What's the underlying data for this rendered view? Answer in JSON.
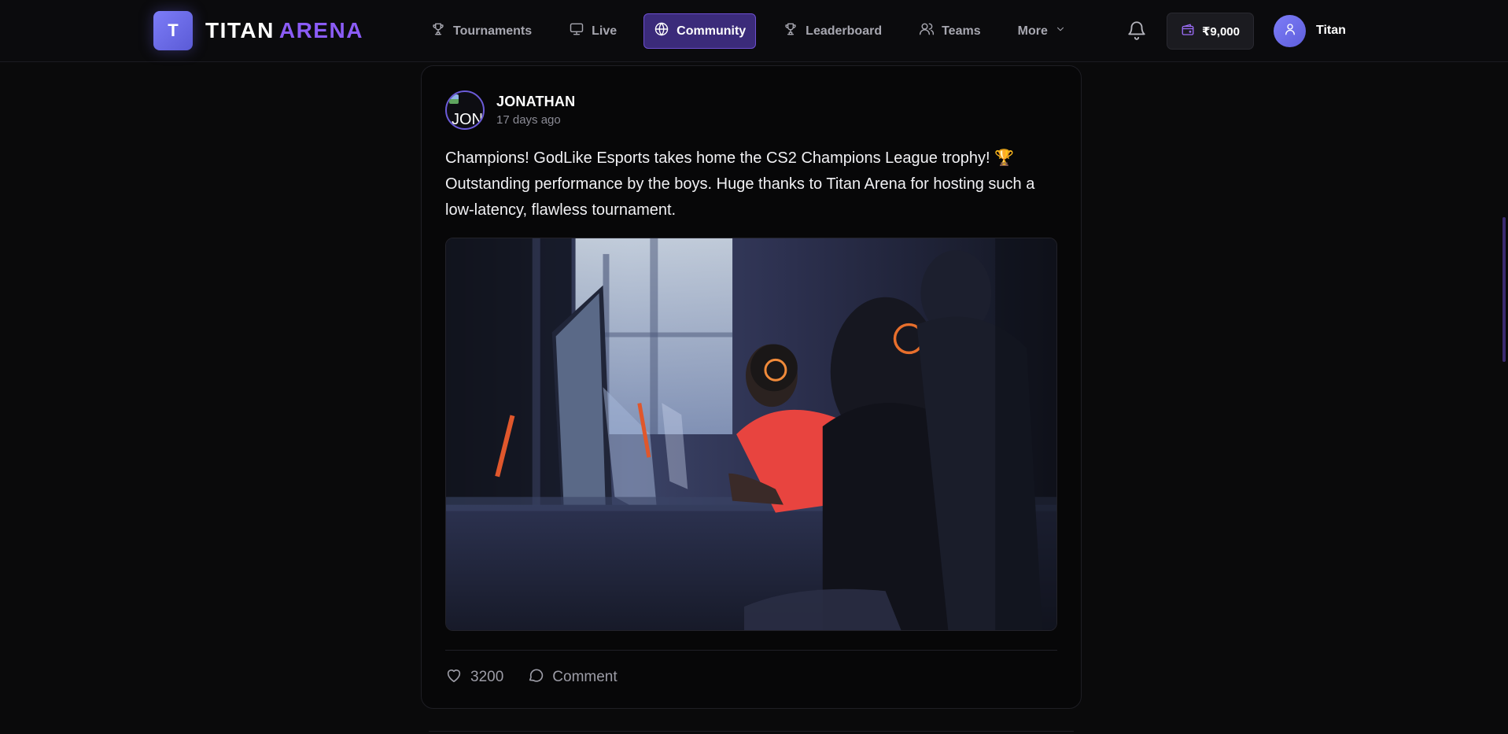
{
  "brand": {
    "badge_letter": "T",
    "word1": "TITAN",
    "word2": "ARENA",
    "accent": "#8b5cf6"
  },
  "nav": {
    "items": [
      {
        "label": "Tournaments",
        "icon": "trophy-icon"
      },
      {
        "label": "Live",
        "icon": "monitor-icon"
      },
      {
        "label": "Community",
        "icon": "globe-icon",
        "active": true
      },
      {
        "label": "Leaderboard",
        "icon": "trophy-icon"
      },
      {
        "label": "Teams",
        "icon": "users-icon"
      },
      {
        "label": "More",
        "icon": "chevron-down-icon"
      }
    ]
  },
  "header": {
    "wallet_balance": "₹9,000",
    "user_name": "Titan"
  },
  "post": {
    "author": "JONATHAN",
    "avatar_alt": "JON",
    "time": "17 days ago",
    "text": "Champions! GodLike Esports takes home the CS2 Champions League trophy! 🏆 Outstanding performance by the boys. Huge thanks to Titan Arena for hosting such a low-latency, flawless tournament.",
    "likes": "3200",
    "comment_label": "Comment"
  }
}
